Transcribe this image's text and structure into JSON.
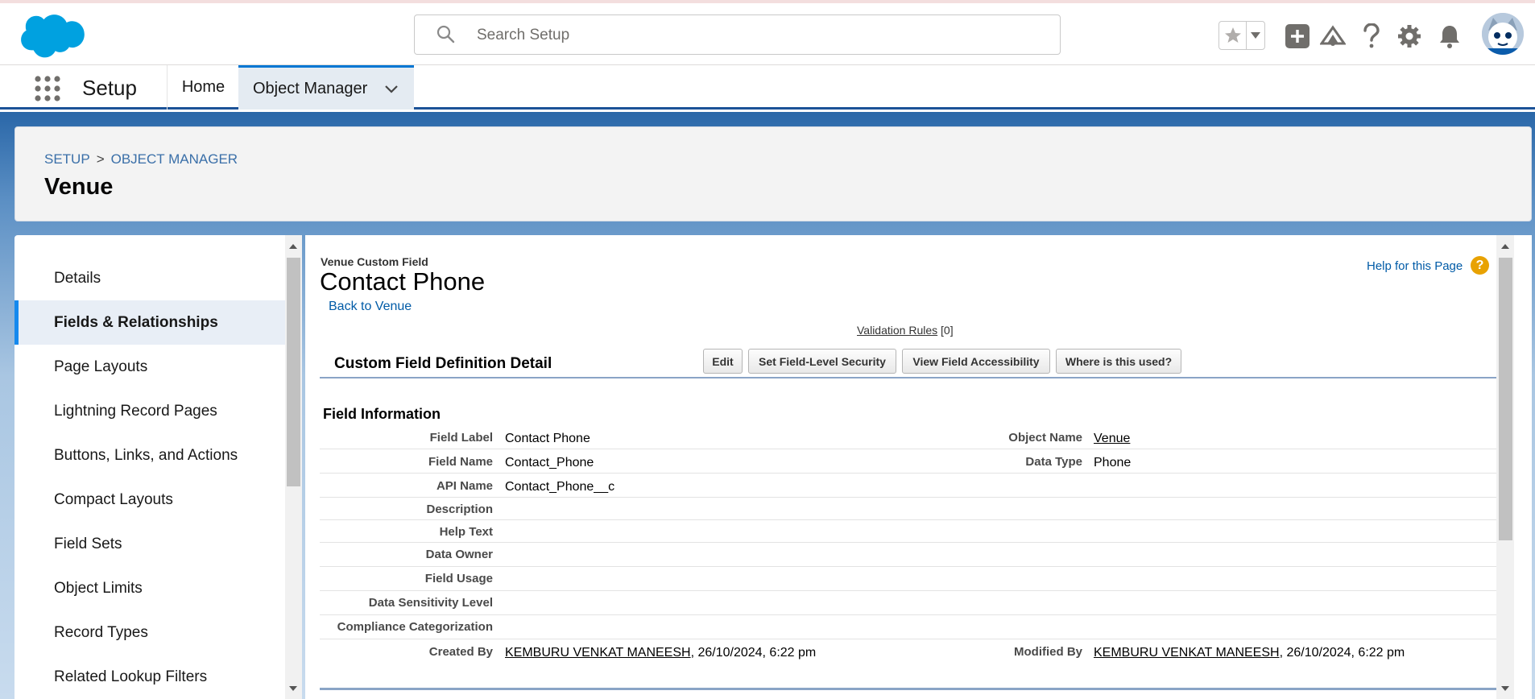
{
  "header": {
    "search_placeholder": "Search Setup"
  },
  "nav": {
    "app_name": "Setup",
    "tabs": [
      {
        "label": "Home"
      },
      {
        "label": "Object Manager"
      }
    ]
  },
  "page_header": {
    "breadcrumb": [
      "SETUP",
      "OBJECT MANAGER"
    ],
    "breadcrumb_sep": ">",
    "title": "Venue"
  },
  "sidebar": {
    "items": [
      {
        "label": "Details"
      },
      {
        "label": "Fields & Relationships",
        "active": true
      },
      {
        "label": "Page Layouts"
      },
      {
        "label": "Lightning Record Pages"
      },
      {
        "label": "Buttons, Links, and Actions"
      },
      {
        "label": "Compact Layouts"
      },
      {
        "label": "Field Sets"
      },
      {
        "label": "Object Limits"
      },
      {
        "label": "Record Types"
      },
      {
        "label": "Related Lookup Filters"
      }
    ]
  },
  "detail": {
    "object_label": "Venue Custom Field",
    "field_title": "Contact Phone",
    "back_link": "Back to Venue",
    "help_link": "Help for this Page",
    "help_badge": "?",
    "validation_link": "Validation Rules",
    "validation_count": "[0]",
    "section_title": "Custom Field Definition Detail",
    "buttons": [
      "Edit",
      "Set Field-Level Security",
      "View Field Accessibility",
      "Where is this used?"
    ],
    "subsection": "Field Information",
    "rows": [
      {
        "label": "Field Label",
        "value": "Contact Phone",
        "label2": "Object Name",
        "value2": "Venue"
      },
      {
        "label": "Field Name",
        "value": "Contact_Phone",
        "label2": "Data Type",
        "value2": "Phone"
      },
      {
        "label": "API Name",
        "value": "Contact_Phone__c"
      },
      {
        "label": "Description",
        "value": ""
      },
      {
        "label": "Help Text",
        "value": ""
      },
      {
        "label": "Data Owner",
        "value": ""
      },
      {
        "label": "Field Usage",
        "value": ""
      },
      {
        "label": "Data Sensitivity Level",
        "value": ""
      },
      {
        "label": "Compliance Categorization",
        "value": ""
      }
    ],
    "created": {
      "label": "Created By",
      "user": "KEMBURU VENKAT MANEESH",
      "date": ", 26/10/2024, 6:22 pm"
    },
    "modified": {
      "label": "Modified By",
      "user": "KEMBURU VENKAT MANEESH",
      "date": ", 26/10/2024, 6:22 pm"
    }
  },
  "colors": {
    "brand_blue": "#0176d3",
    "link_blue": "#015ba7",
    "logo_blue": "#00a1e0",
    "help_orange": "#e8a202"
  }
}
